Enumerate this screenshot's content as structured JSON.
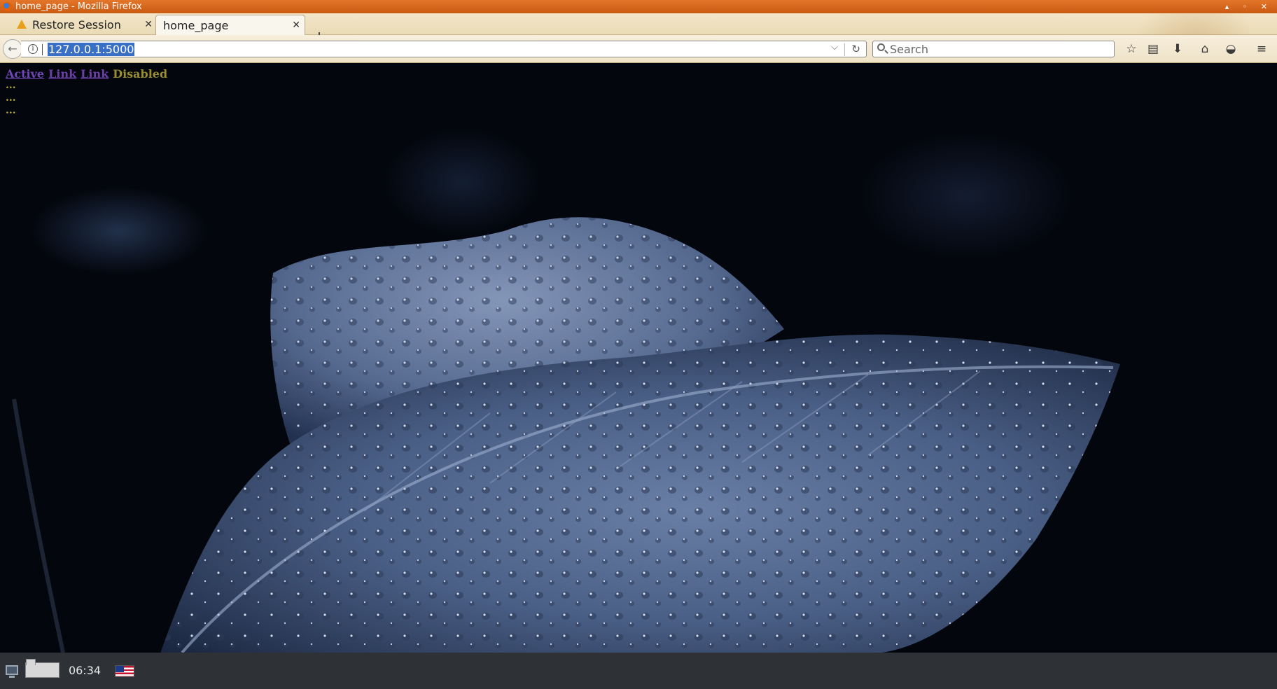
{
  "window": {
    "title": "home_page - Mozilla Firefox",
    "controls": "▴ ◦ ✕"
  },
  "tabs": [
    {
      "label": "Restore Session",
      "icon": "warning-icon",
      "active": false
    },
    {
      "label": "home_page",
      "active": true
    }
  ],
  "newtab_label": "+",
  "navbar": {
    "back_icon": "←",
    "url": "127.0.0.1:5000",
    "search_placeholder": "Search",
    "toolbar_icons": {
      "bookmark": "☆",
      "reading_list": "▤",
      "downloads": "⬇",
      "home": "⌂",
      "pocket": "◒",
      "menu": "≡"
    }
  },
  "page": {
    "nav_links": {
      "active": "Active",
      "link1": "Link",
      "link2": "Link",
      "disabled": "Disabled"
    },
    "dots": [
      "...",
      "...",
      "..."
    ]
  },
  "taskbar": {
    "clock": "06:34",
    "keyboard_layout_icon": "us-flag-icon"
  }
}
